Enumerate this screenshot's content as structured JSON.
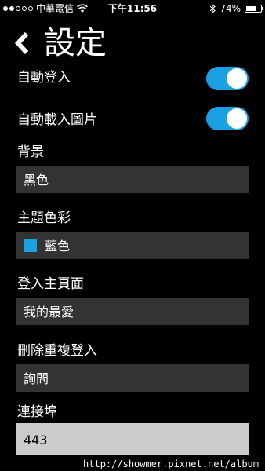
{
  "status_bar": {
    "carrier": "中華電信",
    "signal_strength": 2,
    "time": "下午11:56",
    "battery": "74%",
    "battery_level": 0.74
  },
  "header": {
    "title": "設定",
    "back_icon": "chevron-left-icon"
  },
  "settings": {
    "auto_login": {
      "label": "自動登入",
      "enabled": true
    },
    "auto_load_images": {
      "label": "自動載入圖片",
      "enabled": true
    },
    "background": {
      "label": "背景",
      "value": "黑色"
    },
    "theme_color": {
      "label": "主題色彩",
      "value": "藍色",
      "swatch_color": "#1ba1e2"
    },
    "home_page": {
      "label": "登入主頁面",
      "value": "我的最愛"
    },
    "delete_duplicate": {
      "label": "刪除重複登入",
      "value": "詢問"
    },
    "port": {
      "label": "連接埠",
      "value": "443"
    }
  },
  "colors": {
    "accent": "#1ba1e2",
    "field_bg": "#333333",
    "input_bg": "#cccccc"
  },
  "watermark": "http://showmer.pixnet.net/album"
}
